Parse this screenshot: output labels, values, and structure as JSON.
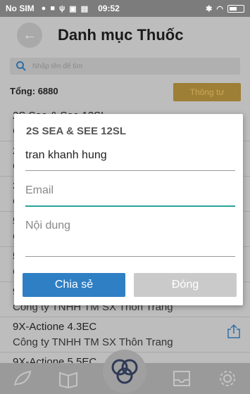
{
  "status_bar": {
    "carrier": "No SIM",
    "time": "09:52"
  },
  "header": {
    "title": "Danh mục Thuốc"
  },
  "search": {
    "placeholder": "Nhập tên để tìm"
  },
  "summary": {
    "total": "Tổng: 6880",
    "thong_tu_label": "Thông tư"
  },
  "list": {
    "items": [
      {
        "name": "2S Sea & See 12SL",
        "company": "C"
      },
      {
        "name": "2",
        "company": "C"
      },
      {
        "name": "3",
        "company": "C"
      },
      {
        "name": "5",
        "company": "C"
      },
      {
        "name": "5",
        "company": "C"
      },
      {
        "name": "9",
        "company": "Công ty TNHH TM SX Thôn Trang"
      },
      {
        "name": "9X-Actione 4.3EC",
        "company": "Công ty TNHH TM SX Thôn Trang"
      },
      {
        "name": "9X-Actione 5.5EC",
        "company": ""
      }
    ]
  },
  "dialog": {
    "title": "2S SEA & SEE 12SL",
    "name_value": "tran khanh hung",
    "email_placeholder": "Email",
    "content_placeholder": "Nội dung",
    "share_label": "Chia sẻ",
    "close_label": "Đóng"
  },
  "colors": {
    "accent": "#2f7fc4",
    "focus": "#2aa39a",
    "gold": "#9d7f36"
  }
}
